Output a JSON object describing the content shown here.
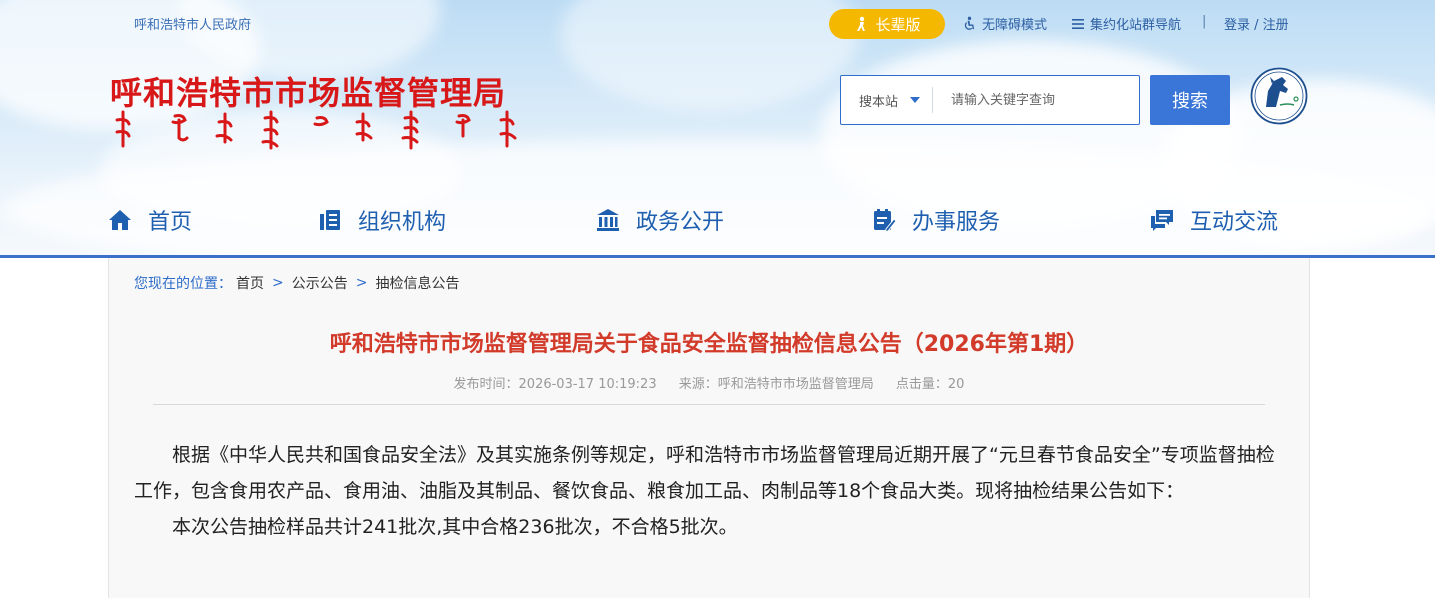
{
  "header": {
    "gov_link": "呼和浩特市人民政府",
    "elder_mode": "长辈版",
    "accessibility": "无障碍模式",
    "site_nav": "集约化站群导航",
    "login": "登录 / 注册",
    "site_title": "呼和浩特市市场监督管理局",
    "search": {
      "scope": "搜本站",
      "placeholder": "请输入关键字查询",
      "button": "搜索"
    }
  },
  "nav": [
    {
      "label": "首页",
      "icon": "home-icon"
    },
    {
      "label": "组织机构",
      "icon": "org-icon"
    },
    {
      "label": "政务公开",
      "icon": "government-icon"
    },
    {
      "label": "办事服务",
      "icon": "service-icon"
    },
    {
      "label": "互动交流",
      "icon": "chat-icon"
    }
  ],
  "breadcrumb": {
    "label": "您现在的位置：",
    "items": [
      "首页",
      "公示公告",
      "抽检信息公告"
    ],
    "separator": ">"
  },
  "article": {
    "title": "呼和浩特市市场监督管理局关于食品安全监督抽检信息公告（2026年第1期）",
    "publish_time": "发布时间：2026-03-17 10:19:23",
    "source": "来源：呼和浩特市市场监督管理局",
    "views": "点击量：20",
    "paragraphs": [
      "根据《中华人民共和国食品安全法》及其实施条例等规定，呼和浩特市市场监督管理局近期开展了“元旦春节食品安全”专项监督抽检工作，包含食用农产品、食用油、油脂及其制品、餐饮食品、粮食加工品、肉制品等18个食品大类。现将抽检结果公告如下：",
      "本次公告抽检样品共计241批次,其中合格236批次，不合格5批次。"
    ]
  },
  "colors": {
    "title_red": "#d81818",
    "primary_blue": "#3a75d8",
    "elder_yellow": "#f5b800"
  }
}
